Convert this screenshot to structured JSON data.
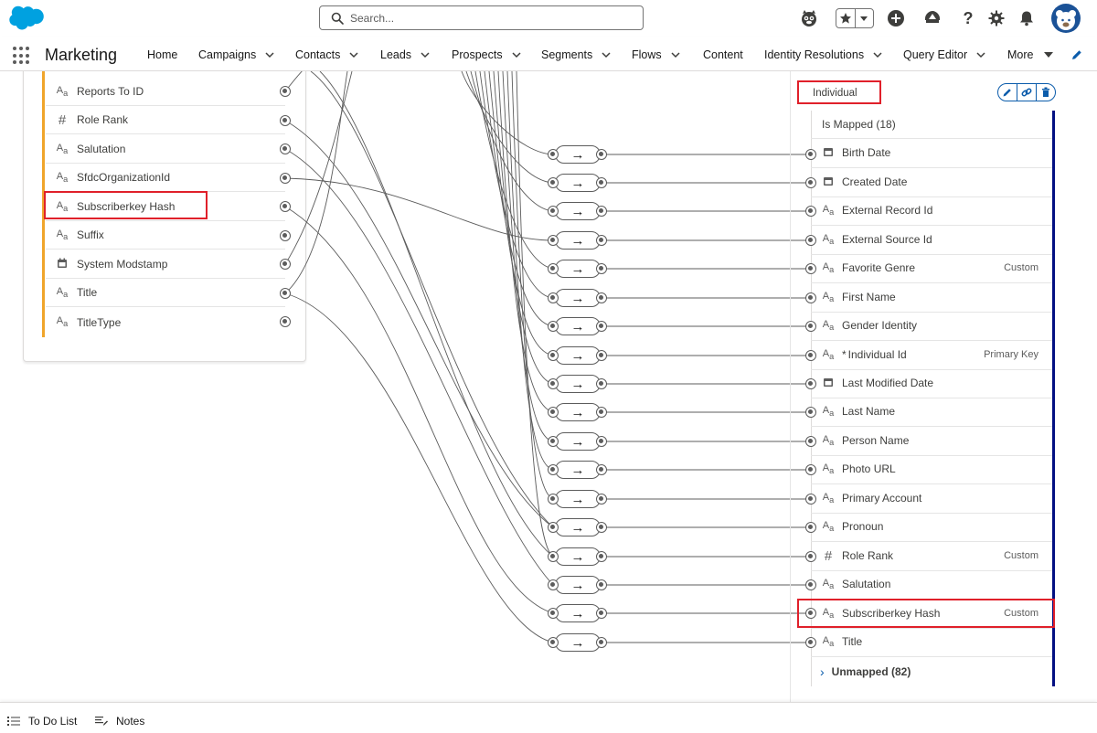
{
  "header": {
    "search_placeholder": "Search...",
    "icons": [
      "salesforce-cloud-logo",
      "astro-icon",
      "star-icon",
      "chevron-down-icon",
      "add-icon",
      "trailhead-icon",
      "help-icon",
      "gear-icon",
      "bell-icon",
      "user-avatar"
    ]
  },
  "nav": {
    "app_name": "Marketing",
    "items": [
      {
        "label": "Home",
        "has_menu": false
      },
      {
        "label": "Campaigns",
        "has_menu": true
      },
      {
        "label": "Contacts",
        "has_menu": true
      },
      {
        "label": "Leads",
        "has_menu": true
      },
      {
        "label": "Prospects",
        "has_menu": true
      },
      {
        "label": "Segments",
        "has_menu": true
      },
      {
        "label": "Flows",
        "has_menu": true
      },
      {
        "label": "Content",
        "has_menu": false
      },
      {
        "label": "Identity Resolutions",
        "has_menu": true
      },
      {
        "label": "Query Editor",
        "has_menu": true
      }
    ],
    "more_label": "More"
  },
  "source_fields": [
    {
      "label": "Reports To ID",
      "type": "text"
    },
    {
      "label": "Role Rank",
      "type": "number"
    },
    {
      "label": "Salutation",
      "type": "text"
    },
    {
      "label": "SfdcOrganizationId",
      "type": "text"
    },
    {
      "label": "Subscriberkey Hash",
      "type": "text"
    },
    {
      "label": "Suffix",
      "type": "text"
    },
    {
      "label": "System Modstamp",
      "type": "date"
    },
    {
      "label": "Title",
      "type": "text"
    },
    {
      "label": "TitleType",
      "type": "text"
    }
  ],
  "target": {
    "object_name": "Individual",
    "mapped_label": "Is Mapped (18)",
    "fields": [
      {
        "label": "Birth Date",
        "type": "date",
        "tag": ""
      },
      {
        "label": "Created Date",
        "type": "date",
        "tag": ""
      },
      {
        "label": "External Record Id",
        "type": "text",
        "tag": ""
      },
      {
        "label": "External Source Id",
        "type": "text",
        "tag": ""
      },
      {
        "label": "Favorite Genre",
        "type": "text",
        "tag": "Custom"
      },
      {
        "label": "First Name",
        "type": "text",
        "tag": ""
      },
      {
        "label": "Gender Identity",
        "type": "text",
        "tag": ""
      },
      {
        "label": "Individual Id",
        "type": "text",
        "tag": "Primary Key",
        "required": "*"
      },
      {
        "label": "Last Modified Date",
        "type": "date",
        "tag": ""
      },
      {
        "label": "Last Name",
        "type": "text",
        "tag": ""
      },
      {
        "label": "Person Name",
        "type": "text",
        "tag": ""
      },
      {
        "label": "Photo URL",
        "type": "text",
        "tag": ""
      },
      {
        "label": "Primary Account",
        "type": "text",
        "tag": ""
      },
      {
        "label": "Pronoun",
        "type": "text",
        "tag": ""
      },
      {
        "label": "Role Rank",
        "type": "number",
        "tag": "Custom"
      },
      {
        "label": "Salutation",
        "type": "text",
        "tag": ""
      },
      {
        "label": "Subscriberkey Hash",
        "type": "text",
        "tag": "Custom"
      },
      {
        "label": "Title",
        "type": "text",
        "tag": ""
      }
    ],
    "unmapped_label": "Unmapped (82)"
  },
  "utility": {
    "todo_label": "To Do List",
    "notes_label": "Notes"
  },
  "colors": {
    "highlight": "#e0202a",
    "source_accent": "#f0a52b",
    "target_accent": "#031082",
    "link_blue": "#0b5cab"
  }
}
